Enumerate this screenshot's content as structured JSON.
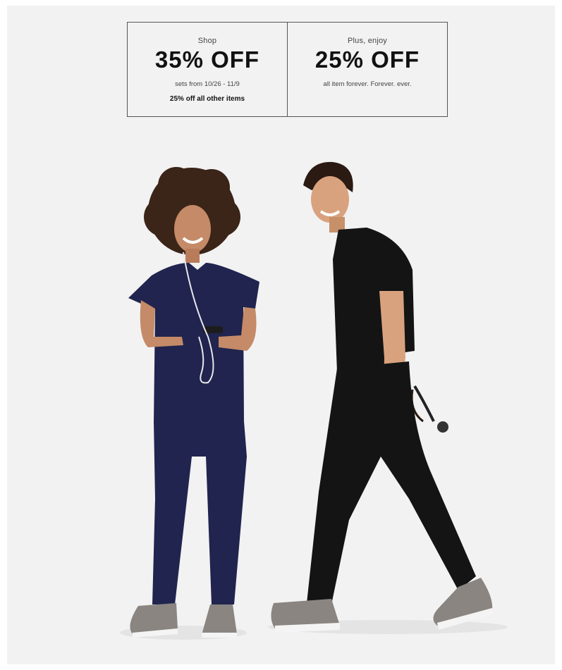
{
  "promo": {
    "left": {
      "kicker": "Shop",
      "headline": "35% OFF",
      "subtext": "sets from 10/26 - 11/9",
      "note": "25% off all other items"
    },
    "right": {
      "kicker": "Plus, enjoy",
      "headline": "25% OFF",
      "subtext": "all item forever. Forever. ever."
    }
  },
  "colors": {
    "background": "#f2f2f2",
    "border": "#555555",
    "navy_scrubs": "#20244f",
    "black_scrubs": "#141414",
    "sneaker": "#8a8580"
  },
  "hero": {
    "image": "two-models-in-scrubs"
  }
}
